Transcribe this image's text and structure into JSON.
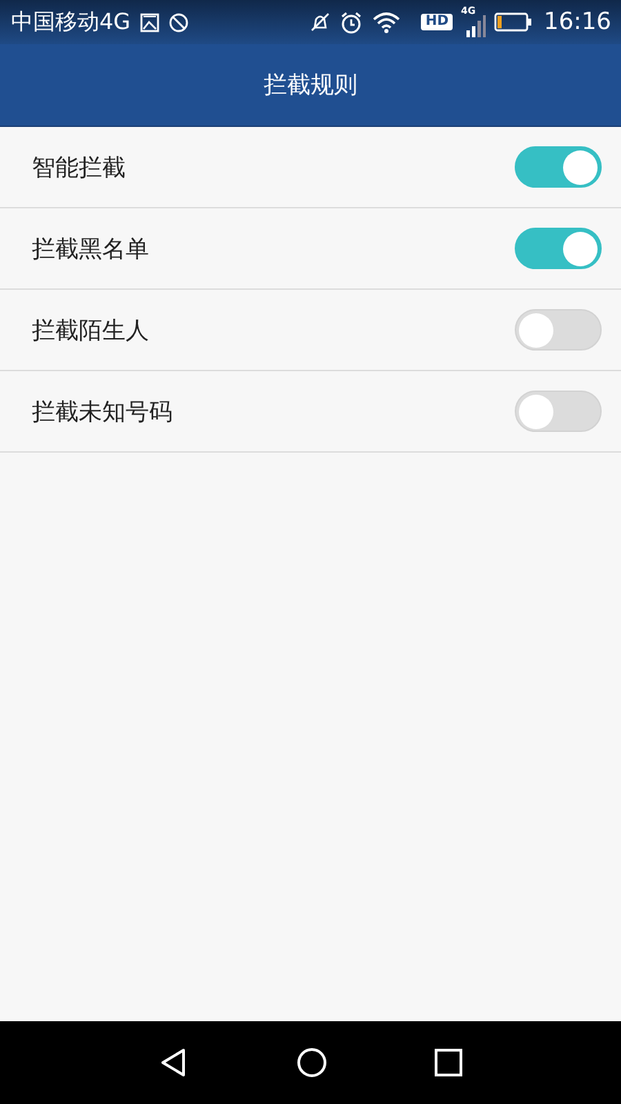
{
  "status_bar": {
    "carrier": "中国移动4G",
    "hd_badge": "HD",
    "network_type": "4G",
    "time": "16:16"
  },
  "header": {
    "title": "拦截规则"
  },
  "settings": [
    {
      "label": "智能拦截",
      "on": true
    },
    {
      "label": "拦截黑名单",
      "on": true
    },
    {
      "label": "拦截陌生人",
      "on": false
    },
    {
      "label": "拦截未知号码",
      "on": false
    }
  ]
}
